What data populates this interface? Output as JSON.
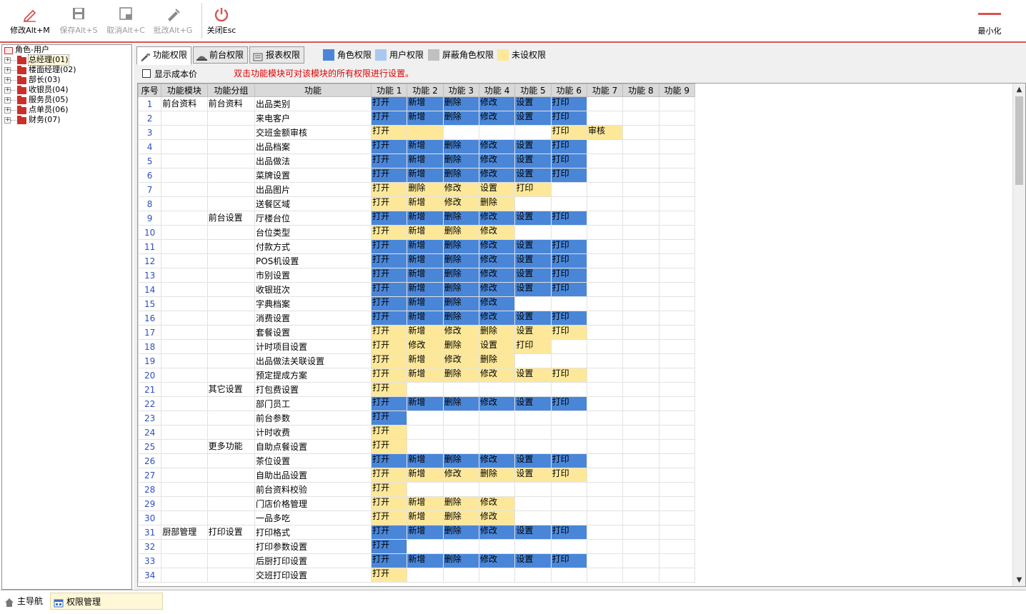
{
  "toolbar": {
    "buttons": [
      {
        "label": "修改Alt+M",
        "icon": "pencil-icon",
        "enabled": true
      },
      {
        "label": "保存Alt+S",
        "icon": "save-icon",
        "enabled": false
      },
      {
        "label": "取消Alt+C",
        "icon": "cancel-icon",
        "enabled": false
      },
      {
        "label": "批改Alt+G",
        "icon": "batch-edit-icon",
        "enabled": false
      },
      {
        "label": "关闭Esc",
        "icon": "power-icon",
        "enabled": true
      }
    ],
    "minimize_label": "最小化"
  },
  "tree": {
    "root": "角色-用户",
    "items": [
      "总经理(01)",
      "楼面经理(02)",
      "部长(03)",
      "收银员(04)",
      "服务员(05)",
      "点单员(06)",
      "财务(07)"
    ]
  },
  "tabs": [
    {
      "label": "功能权限"
    },
    {
      "label": "前台权限"
    },
    {
      "label": "报表权限"
    }
  ],
  "legend": [
    {
      "label": "角色权限",
      "color": "#4a86d8"
    },
    {
      "label": "用户权限",
      "color": "#a9c8f0"
    },
    {
      "label": "屏蔽角色权限",
      "color": "#c0c0c0"
    },
    {
      "label": "未设权限",
      "color": "#fde89a"
    }
  ],
  "show_cost_label": "显示成本价",
  "hint": "双击功能模块可对该模块的所有权限进行设置。",
  "grid": {
    "columns": [
      "序号",
      "功能模块",
      "功能分组",
      "功能",
      "功能 1",
      "功能 2",
      "功能 3",
      "功能 4",
      "功能 5",
      "功能 6",
      "功能 7",
      "功能 8",
      "功能 9"
    ],
    "rows": [
      {
        "no": "1",
        "module": "前台资料",
        "group": "前台资料",
        "func": "出品类别",
        "perms": [
          [
            "打开",
            "B"
          ],
          [
            "新增",
            "B"
          ],
          [
            "删除",
            "B"
          ],
          [
            "修改",
            "B"
          ],
          [
            "设置",
            "B"
          ],
          [
            "打印",
            "B"
          ]
        ]
      },
      {
        "no": "2",
        "module": "",
        "group": "",
        "func": "来电客户",
        "perms": [
          [
            "打开",
            "B"
          ],
          [
            "新增",
            "B"
          ],
          [
            "删除",
            "B"
          ],
          [
            "修改",
            "B"
          ],
          [
            "设置",
            "B"
          ],
          [
            "打印",
            "B"
          ]
        ]
      },
      {
        "no": "3",
        "module": "",
        "group": "",
        "func": "交班金额审核",
        "perms": [
          [
            "打开",
            "Y"
          ],
          [
            "",
            "Y"
          ],
          [
            "",
            ""
          ],
          [
            "",
            ""
          ],
          [
            "",
            ""
          ],
          [
            "打印",
            "Y"
          ],
          [
            "审核",
            "Y"
          ]
        ]
      },
      {
        "no": "4",
        "module": "",
        "group": "",
        "func": "出品档案",
        "perms": [
          [
            "打开",
            "B"
          ],
          [
            "新增",
            "B"
          ],
          [
            "删除",
            "B"
          ],
          [
            "修改",
            "B"
          ],
          [
            "设置",
            "B"
          ],
          [
            "打印",
            "B"
          ]
        ]
      },
      {
        "no": "5",
        "module": "",
        "group": "",
        "func": "出品做法",
        "perms": [
          [
            "打开",
            "B"
          ],
          [
            "新增",
            "B"
          ],
          [
            "删除",
            "B"
          ],
          [
            "修改",
            "B"
          ],
          [
            "设置",
            "B"
          ],
          [
            "打印",
            "B"
          ]
        ]
      },
      {
        "no": "6",
        "module": "",
        "group": "",
        "func": "菜牌设置",
        "perms": [
          [
            "打开",
            "B"
          ],
          [
            "新增",
            "B"
          ],
          [
            "删除",
            "B"
          ],
          [
            "修改",
            "B"
          ],
          [
            "设置",
            "B"
          ],
          [
            "打印",
            "B"
          ]
        ]
      },
      {
        "no": "7",
        "module": "",
        "group": "",
        "func": "出品图片",
        "perms": [
          [
            "打开",
            "Y"
          ],
          [
            "删除",
            "Y"
          ],
          [
            "修改",
            "Y"
          ],
          [
            "设置",
            "Y"
          ],
          [
            "打印",
            "Y"
          ]
        ]
      },
      {
        "no": "8",
        "module": "",
        "group": "",
        "func": "送餐区域",
        "perms": [
          [
            "打开",
            "Y"
          ],
          [
            "新增",
            "Y"
          ],
          [
            "修改",
            "Y"
          ],
          [
            "删除",
            "Y"
          ]
        ]
      },
      {
        "no": "9",
        "module": "",
        "group": "前台设置",
        "func": "厅楼台位",
        "perms": [
          [
            "打开",
            "B"
          ],
          [
            "新增",
            "B"
          ],
          [
            "删除",
            "B"
          ],
          [
            "修改",
            "B"
          ],
          [
            "设置",
            "B"
          ],
          [
            "打印",
            "B"
          ]
        ]
      },
      {
        "no": "10",
        "module": "",
        "group": "",
        "func": "台位类型",
        "perms": [
          [
            "打开",
            "Y"
          ],
          [
            "新增",
            "Y"
          ],
          [
            "删除",
            "Y"
          ],
          [
            "修改",
            "Y"
          ]
        ]
      },
      {
        "no": "11",
        "module": "",
        "group": "",
        "func": "付款方式",
        "perms": [
          [
            "打开",
            "B"
          ],
          [
            "新增",
            "B"
          ],
          [
            "删除",
            "B"
          ],
          [
            "修改",
            "B"
          ],
          [
            "设置",
            "B"
          ],
          [
            "打印",
            "B"
          ]
        ]
      },
      {
        "no": "12",
        "module": "",
        "group": "",
        "func": "POS机设置",
        "perms": [
          [
            "打开",
            "B"
          ],
          [
            "新增",
            "B"
          ],
          [
            "删除",
            "B"
          ],
          [
            "修改",
            "B"
          ],
          [
            "设置",
            "B"
          ],
          [
            "打印",
            "B"
          ]
        ]
      },
      {
        "no": "13",
        "module": "",
        "group": "",
        "func": "市别设置",
        "perms": [
          [
            "打开",
            "B"
          ],
          [
            "新增",
            "B"
          ],
          [
            "删除",
            "B"
          ],
          [
            "修改",
            "B"
          ],
          [
            "设置",
            "B"
          ],
          [
            "打印",
            "B"
          ]
        ]
      },
      {
        "no": "14",
        "module": "",
        "group": "",
        "func": "收银班次",
        "perms": [
          [
            "打开",
            "B"
          ],
          [
            "新增",
            "B"
          ],
          [
            "删除",
            "B"
          ],
          [
            "修改",
            "B"
          ],
          [
            "设置",
            "B"
          ],
          [
            "打印",
            "B"
          ]
        ]
      },
      {
        "no": "15",
        "module": "",
        "group": "",
        "func": "字典档案",
        "perms": [
          [
            "打开",
            "B"
          ],
          [
            "新增",
            "B"
          ],
          [
            "删除",
            "B"
          ],
          [
            "修改",
            "B"
          ]
        ]
      },
      {
        "no": "16",
        "module": "",
        "group": "",
        "func": "消费设置",
        "perms": [
          [
            "打开",
            "B"
          ],
          [
            "新增",
            "B"
          ],
          [
            "删除",
            "B"
          ],
          [
            "修改",
            "B"
          ],
          [
            "设置",
            "B"
          ],
          [
            "打印",
            "B"
          ]
        ]
      },
      {
        "no": "17",
        "module": "",
        "group": "",
        "func": "套餐设置",
        "perms": [
          [
            "打开",
            "Y"
          ],
          [
            "新增",
            "Y"
          ],
          [
            "修改",
            "Y"
          ],
          [
            "删除",
            "Y"
          ],
          [
            "设置",
            "Y"
          ],
          [
            "打印",
            "Y"
          ]
        ]
      },
      {
        "no": "18",
        "module": "",
        "group": "",
        "func": "计时项目设置",
        "perms": [
          [
            "打开",
            "Y"
          ],
          [
            "修改",
            "Y"
          ],
          [
            "删除",
            "Y"
          ],
          [
            "设置",
            "Y"
          ],
          [
            "打印",
            "Y"
          ]
        ]
      },
      {
        "no": "19",
        "module": "",
        "group": "",
        "func": "出品做法关联设置",
        "perms": [
          [
            "打开",
            "Y"
          ],
          [
            "新增",
            "Y"
          ],
          [
            "修改",
            "Y"
          ],
          [
            "删除",
            "Y"
          ]
        ]
      },
      {
        "no": "20",
        "module": "",
        "group": "",
        "func": "预定提成方案",
        "perms": [
          [
            "打开",
            "Y"
          ],
          [
            "新增",
            "Y"
          ],
          [
            "删除",
            "Y"
          ],
          [
            "修改",
            "Y"
          ],
          [
            "设置",
            "Y"
          ],
          [
            "打印",
            "Y"
          ]
        ]
      },
      {
        "no": "21",
        "module": "",
        "group": "其它设置",
        "func": "打包费设置",
        "perms": [
          [
            "打开",
            "Y"
          ]
        ]
      },
      {
        "no": "22",
        "module": "",
        "group": "",
        "func": "部门员工",
        "perms": [
          [
            "打开",
            "B"
          ],
          [
            "新增",
            "B"
          ],
          [
            "删除",
            "B"
          ],
          [
            "修改",
            "B"
          ],
          [
            "设置",
            "B"
          ],
          [
            "打印",
            "B"
          ]
        ]
      },
      {
        "no": "23",
        "module": "",
        "group": "",
        "func": "前台参数",
        "perms": [
          [
            "打开",
            "B"
          ]
        ]
      },
      {
        "no": "24",
        "module": "",
        "group": "",
        "func": "计时收费",
        "perms": [
          [
            "打开",
            "Y"
          ]
        ]
      },
      {
        "no": "25",
        "module": "",
        "group": "更多功能",
        "func": "自助点餐设置",
        "perms": [
          [
            "打开",
            "Y"
          ]
        ]
      },
      {
        "no": "26",
        "module": "",
        "group": "",
        "func": "茶位设置",
        "perms": [
          [
            "打开",
            "B"
          ],
          [
            "新增",
            "B"
          ],
          [
            "删除",
            "B"
          ],
          [
            "修改",
            "B"
          ],
          [
            "设置",
            "B"
          ],
          [
            "打印",
            "B"
          ]
        ]
      },
      {
        "no": "27",
        "module": "",
        "group": "",
        "func": "自助出品设置",
        "perms": [
          [
            "打开",
            "Y"
          ],
          [
            "新增",
            "Y"
          ],
          [
            "修改",
            "Y"
          ],
          [
            "删除",
            "Y"
          ],
          [
            "设置",
            "Y"
          ],
          [
            "打印",
            "Y"
          ]
        ]
      },
      {
        "no": "28",
        "module": "",
        "group": "",
        "func": "前台资料校验",
        "perms": [
          [
            "打开",
            "Y"
          ]
        ]
      },
      {
        "no": "29",
        "module": "",
        "group": "",
        "func": "门店价格管理",
        "perms": [
          [
            "打开",
            "Y"
          ],
          [
            "新增",
            "Y"
          ],
          [
            "删除",
            "Y"
          ],
          [
            "修改",
            "Y"
          ]
        ]
      },
      {
        "no": "30",
        "module": "",
        "group": "",
        "func": "一品多吃",
        "perms": [
          [
            "打开",
            "Y"
          ],
          [
            "新增",
            "Y"
          ],
          [
            "删除",
            "Y"
          ],
          [
            "修改",
            "Y"
          ]
        ]
      },
      {
        "no": "31",
        "module": "厨部管理",
        "group": "打印设置",
        "func": "打印格式",
        "perms": [
          [
            "打开",
            "B"
          ],
          [
            "新增",
            "B"
          ],
          [
            "删除",
            "B"
          ],
          [
            "修改",
            "B"
          ],
          [
            "设置",
            "B"
          ],
          [
            "打印",
            "B"
          ]
        ]
      },
      {
        "no": "32",
        "module": "",
        "group": "",
        "func": "打印参数设置",
        "perms": [
          [
            "打开",
            "B"
          ]
        ]
      },
      {
        "no": "33",
        "module": "",
        "group": "",
        "func": "后厨打印设置",
        "perms": [
          [
            "打开",
            "B"
          ],
          [
            "新增",
            "B"
          ],
          [
            "删除",
            "B"
          ],
          [
            "修改",
            "B"
          ],
          [
            "设置",
            "B"
          ],
          [
            "打印",
            "B"
          ]
        ]
      },
      {
        "no": "34",
        "module": "",
        "group": "",
        "func": "交班打印设置",
        "perms": [
          [
            "打开",
            "Y"
          ]
        ]
      }
    ]
  },
  "statusbar": {
    "items": [
      {
        "label": "主导航",
        "icon": "home-icon"
      },
      {
        "label": "权限管理",
        "icon": "window-icon"
      }
    ]
  }
}
